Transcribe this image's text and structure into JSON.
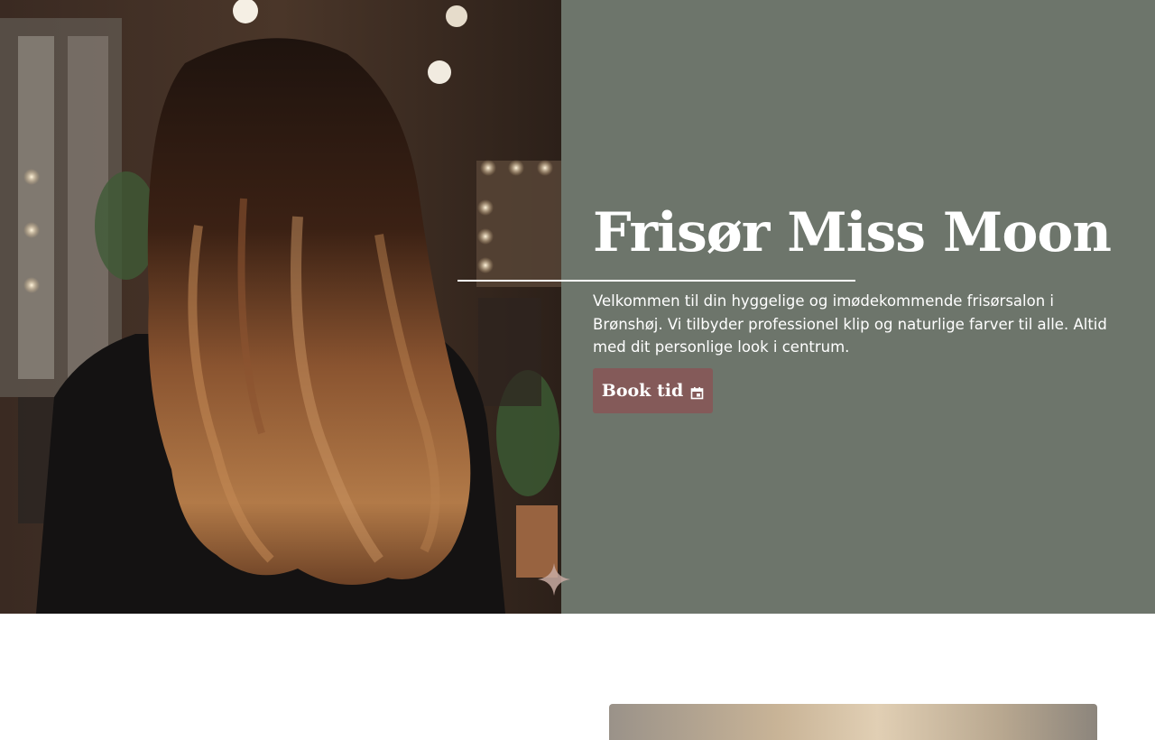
{
  "hero": {
    "title": "Frisør Miss Moon",
    "intro": "Velkommen til din hyggelige og imødekommende frisørsalon i Brønshøj. Vi tilbyder professionel klip og naturlige farver til alle. Altid med dit personlige look i centrum.",
    "book_button_label": "Book tid",
    "book_button_icon": "calendar-icon",
    "photo_description_icon": "hair-photo",
    "colors": {
      "panel": "#6d756b",
      "button": "#845a59",
      "text": "#ffffff"
    }
  },
  "second_section": {
    "photo_icon": "blonde-hair-photo"
  }
}
